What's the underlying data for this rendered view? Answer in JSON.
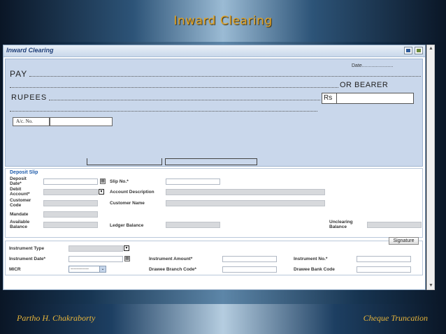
{
  "slide": {
    "title": "Inward Clearing",
    "footer_left": "Partho  H. Chakraborty",
    "footer_right": "Cheque Truncation"
  },
  "window": {
    "title": "Inward Clearing",
    "buttons": [
      "save-icon",
      "exit-icon"
    ]
  },
  "cheque": {
    "date_label": "Date.......................",
    "pay_label": "PAY",
    "bearer_label": "OR BEARER",
    "rupees_label": "RUPEES",
    "rs_label": "Rs",
    "ac_no_label": "A/c. No."
  },
  "deposit_slip": {
    "title": "Deposit Slip",
    "deposit_date_label": "Deposit Date*",
    "debit_account_label": "Debit Account*",
    "customer_code_label": "Customer Code",
    "mandate_label": "Mandate",
    "available_balance_label": "Available Balance",
    "slip_no_label": "Slip No.*",
    "account_description_label": "Account Description",
    "customer_name_label": "Customer Name",
    "ledger_balance_label": "Ledger Balance",
    "unclearing_balance_label": "Unclearing Balance"
  },
  "instrument": {
    "instrument_type_label": "Instrument Type",
    "instrument_date_label": "Instrument Date*",
    "micr_label": "MICR",
    "micr_value": "------------",
    "instrument_amount_label": "Instrument Amount*",
    "drawee_branch_code_label": "Drawee Branch Code*",
    "instrument_no_label": "Instrument No.*",
    "drawee_bank_code_label": "Drawee Bank Code"
  },
  "signature_button": "Signature"
}
